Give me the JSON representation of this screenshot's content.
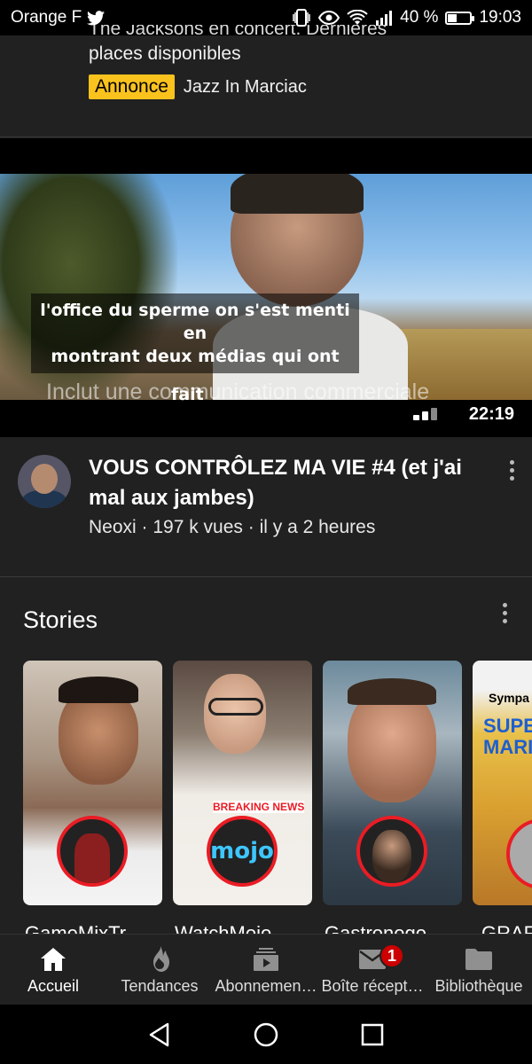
{
  "status_bar": {
    "carrier": "Orange F",
    "battery_percent": "40 %",
    "battery_level": 0.4,
    "time": "19:03"
  },
  "ad": {
    "title_clipped": "The Jacksons en concert. Dernières",
    "title": "places disponibles",
    "badge": "Annonce",
    "advertiser": "Jazz In Marciac"
  },
  "video": {
    "subtitle_line1": "l'office du sperme on s'est menti",
    "subtitle_line2": "en",
    "subtitle_line3": "montrant deux médias qui ont",
    "subtitle_line4": "fait",
    "commercial_notice": "Inclut une communication commerciale",
    "duration": "22:19",
    "title": "VOUS CONTRÔLEZ MA VIE #4 (et j'ai mal aux jambes)",
    "meta": "Neoxi · 197 k vues · il y a 2 heures"
  },
  "stories": {
    "title": "Stories",
    "items": [
      {
        "label": "GameMixTr"
      },
      {
        "label": "WatchMojo"
      },
      {
        "label": "Gastronogo"
      },
      {
        "label": "GRAF"
      }
    ],
    "card2_text": "BREAKING NEWS",
    "card2_logo": "mojo",
    "card4_text": "Sympa",
    "card4_game": "SUPER MARIO"
  },
  "bottom_nav": {
    "items": [
      {
        "label": "Accueil",
        "icon": "home-icon"
      },
      {
        "label": "Tendances",
        "icon": "flame-icon"
      },
      {
        "label": "Abonnemen…",
        "icon": "subscriptions-icon"
      },
      {
        "label": "Boîte récept…",
        "icon": "mail-icon"
      },
      {
        "label": "Bibliothèque",
        "icon": "folder-icon"
      }
    ],
    "inbox_badge": "1"
  },
  "colors": {
    "background": "#212121",
    "ad_badge": "#f9c21d",
    "story_ring": "#ea1c24",
    "notification": "#cc0000"
  }
}
